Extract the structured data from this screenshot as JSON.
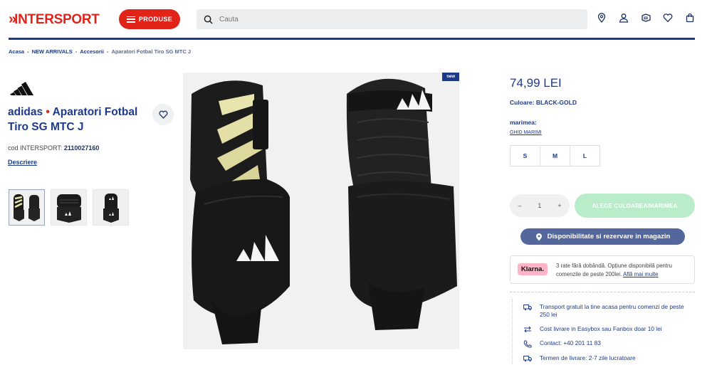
{
  "header": {
    "logo_text": "INTERSPORT",
    "menu_button_label": "PRODUSE",
    "search_placeholder": "Cauta"
  },
  "breadcrumb": [
    "Acasa",
    "NEW ARRIVALS",
    "Accesorii",
    "Aparatori Fotbal Tiro SG MTC J"
  ],
  "product": {
    "brand": "adidas",
    "bullet": "•",
    "name": "Aparatori Fotbal Tiro SG MTC J",
    "cod_label": "cod INTERSPORT:",
    "cod_value": "2110027160",
    "description_link": "Descriere",
    "badge": "new",
    "price": "74,99 LEI",
    "color_label": "Culoare: BLACK-GOLD",
    "size_label": "marimea:",
    "size_guide": "GHID MARIMI",
    "sizes": [
      "S",
      "M",
      "L"
    ],
    "quantity": "1",
    "qty_minus": "–",
    "qty_plus": "+",
    "add_button": "ALEGE CULOAREA/MARIMEA",
    "availability_button": "Disponibilitate si rezervare in magazin"
  },
  "klarna": {
    "logo": "Klarna.",
    "text": "3 rate fără dobândă. Opțiune disponibilă pentru comenzile de peste 200lei.",
    "link": "Află mai multe"
  },
  "info": [
    {
      "icon": "truck-icon",
      "text": "Transport gratuit la tine acasa pentru comenzi de peste 250 lei"
    },
    {
      "icon": "return-arrows-icon",
      "text": "Cost livrare in Easybox sau Fanbox doar 10 lei"
    },
    {
      "icon": "phone-icon",
      "text": "Contact: +40 201 11 83"
    },
    {
      "icon": "delivery-truck-icon",
      "text": "Termen de livrare: 2-7 zile lucratoare"
    }
  ],
  "colors": {
    "brand_blue": "#1d3a8a",
    "brand_red": "#e2231a",
    "add_button": "#b9ecc8",
    "availability_button": "#53679c",
    "klarna_pink": "#ffb3c7"
  }
}
